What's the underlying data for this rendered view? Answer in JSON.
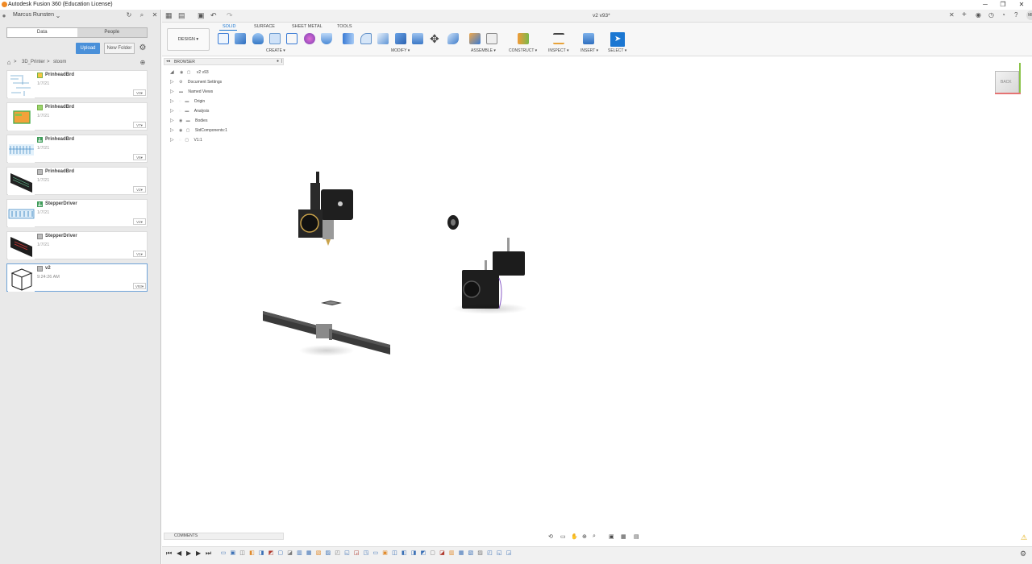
{
  "window": {
    "title": "Autodesk Fusion 360 (Education License)",
    "controls": [
      "─",
      "❐",
      "✕"
    ]
  },
  "data_panel": {
    "user": "Marcus Runsten",
    "tabs": [
      "Data",
      "People"
    ],
    "active_tab": "Data",
    "upload_label": "Upload",
    "new_folder_label": "New Folder",
    "breadcrumb": [
      "3D_Printer",
      "stoom"
    ],
    "items": [
      {
        "name": "PrinheadBrd",
        "date": "1/7/21",
        "version": "V3▾",
        "type": "drawing",
        "thumb": "schematic"
      },
      {
        "name": "PrinheadBrd",
        "date": "1/7/21",
        "version": "V7▾",
        "type": "drawing",
        "thumb": "board-green"
      },
      {
        "name": "PrinheadBrd",
        "date": "1/7/21",
        "version": "V6▾",
        "type": "electronics",
        "thumb": "schematic-blue"
      },
      {
        "name": "PrinheadBrd",
        "date": "1/7/21",
        "version": "V2▾",
        "type": "3d",
        "thumb": "board-dark"
      },
      {
        "name": "StepperDriver",
        "date": "1/7/21",
        "version": "V2▾",
        "type": "electronics",
        "thumb": "schematic-blue"
      },
      {
        "name": "StepperDriver",
        "date": "1/7/21",
        "version": "V1▾",
        "type": "3d",
        "thumb": "board-red"
      },
      {
        "name": "v2",
        "date": "9:24:26 AM",
        "version": "V93▾",
        "type": "3d",
        "thumb": "frame"
      }
    ]
  },
  "document": {
    "title": "v2 v93*"
  },
  "ribbon": {
    "workspace": "DESIGN ▾",
    "tabs": [
      "SOLID",
      "SURFACE",
      "SHEET METAL",
      "TOOLS"
    ],
    "active_tab": "SOLID",
    "groups": [
      "CREATE ▾",
      "MODIFY ▾",
      "ASSEMBLE ▾",
      "CONSTRUCT ▾",
      "INSPECT ▾",
      "INSERT ▾",
      "SELECT ▾"
    ]
  },
  "browser": {
    "title": "BROWSER",
    "root": "v2 v93",
    "nodes": [
      "Document Settings",
      "Named Views",
      "Origin",
      "Analysis",
      "Bodies",
      "StdComponents:1",
      "V1:1"
    ]
  },
  "viewcube": {
    "face": "BACK"
  },
  "comments": {
    "title": "COMMENTS"
  },
  "user_initials": "MR",
  "colors": {
    "accent": "#1b77d2",
    "upload": "#4a90d9"
  }
}
